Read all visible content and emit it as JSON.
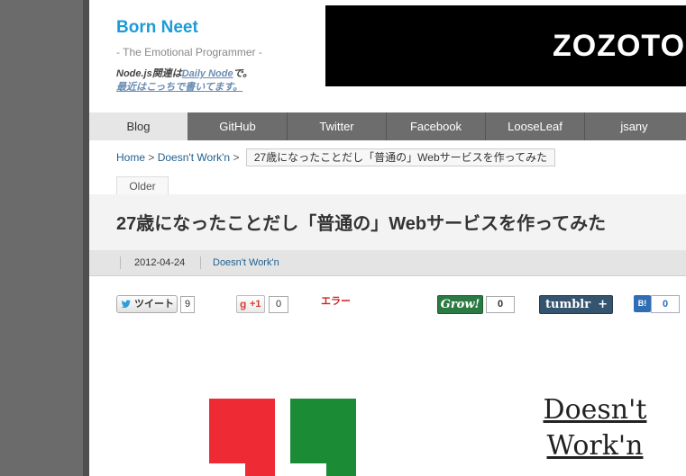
{
  "header": {
    "site_title": "Born Neet",
    "subtitle": "- The Emotional Programmer -",
    "note_prefix": "Node.js関連は",
    "note_link": "Daily Node",
    "note_suffix": "で。",
    "note_line2": "最近はこっちで書いてます。"
  },
  "banner": {
    "text": "ZOZOTO"
  },
  "nav": {
    "items": [
      "Blog",
      "GitHub",
      "Twitter",
      "Facebook",
      "LooseLeaf",
      "jsany"
    ],
    "active_index": 0
  },
  "breadcrumb": {
    "home": "Home",
    "sep1": ">",
    "category": "Doesn't Work'n",
    "sep2": ">",
    "current": "27歳になったことだし「普通の」Webサービスを作ってみた"
  },
  "post": {
    "older_label": "Older",
    "title": "27歳になったことだし「普通の」Webサービスを作ってみた",
    "date": "2012-04-24",
    "category": "Doesn't Work'n"
  },
  "share": {
    "tweet_label": "ツイート",
    "tweet_count": "9",
    "gplus_label": "+1",
    "gplus_count": "0",
    "error_text": "エラー",
    "grow_label": "Grow!",
    "grow_count": "0",
    "tumblr_label": "tumblr",
    "tumblr_plus": "+",
    "hatena_label": "B!",
    "hatena_count": "0"
  },
  "logo": {
    "line1": "Doesn't",
    "line2": "Work'n"
  },
  "colors": {
    "accent": "#1b9bd7",
    "quote_red": "#ee2b35",
    "quote_green": "#1b8c35"
  }
}
